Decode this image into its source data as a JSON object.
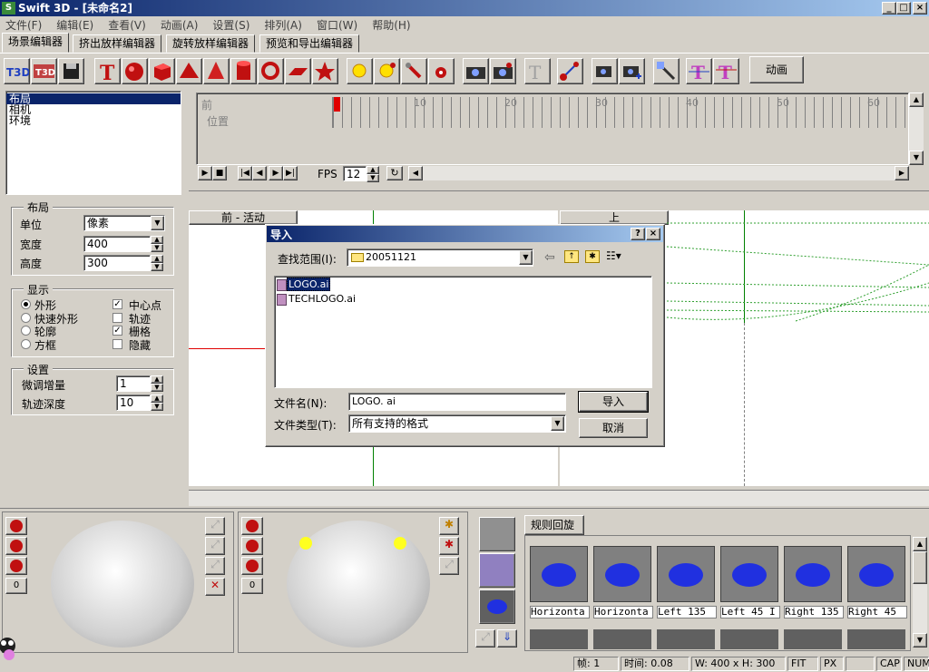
{
  "window": {
    "title": "Swift 3D - [未命名2]"
  },
  "menu": [
    "文件(F)",
    "编辑(E)",
    "查看(V)",
    "动画(A)",
    "设置(S)",
    "排列(A)",
    "窗口(W)",
    "帮助(H)"
  ],
  "tabs": [
    "场景编辑器",
    "挤出放样编辑器",
    "旋转放样编辑器",
    "预览和导出编辑器"
  ],
  "toolbar": {
    "animate_label": "动画"
  },
  "tree": [
    "布局",
    "相机",
    "环境"
  ],
  "layout": {
    "title": "布局",
    "unit_label": "单位",
    "unit_value": "像素",
    "width_label": "宽度",
    "width_value": "400",
    "height_label": "高度",
    "height_value": "300"
  },
  "display": {
    "title": "显示",
    "opt1": "外形",
    "opt2": "快速外形",
    "opt3": "轮廓",
    "opt4": "方框",
    "c1": "中心点",
    "c2": "轨迹",
    "c3": "栅格",
    "c4": "隐藏"
  },
  "settings": {
    "title": "设置",
    "nudge_label": "微调增量",
    "nudge_value": "1",
    "trail_label": "轨迹深度",
    "trail_value": "10"
  },
  "timeline": {
    "row1": "前",
    "row2": "位置",
    "ticks": [
      "10",
      "20",
      "30",
      "40",
      "50",
      "60"
    ],
    "fps_label": "FPS",
    "fps_value": "12"
  },
  "viewports": {
    "front": "前 - 活动",
    "top": "上"
  },
  "dialog": {
    "title": "导入",
    "lookin_label": "查找范围(I):",
    "lookin_value": "20051121",
    "files": [
      "LOGO.ai",
      "TECHLOGO.ai"
    ],
    "filename_label": "文件名(N):",
    "filename_value": "LOGO. ai",
    "filetype_label": "文件类型(T):",
    "filetype_value": "所有支持的格式",
    "ok": "导入",
    "cancel": "取消"
  },
  "gallery": {
    "tab": "规则回旋",
    "labels": [
      "Horizonta",
      "Horizonta",
      "Left 135",
      "Left 45 I",
      "Right 135",
      "Right 45"
    ]
  },
  "trackball": {
    "zero1": "0",
    "zero2": "0"
  },
  "status": {
    "frame": "帧: 1",
    "time": "时间: 0.08",
    "size": "W: 400 x H: 300",
    "fit": "FIT",
    "px": "PX",
    "cap": "CAP",
    "num": "NUM"
  }
}
